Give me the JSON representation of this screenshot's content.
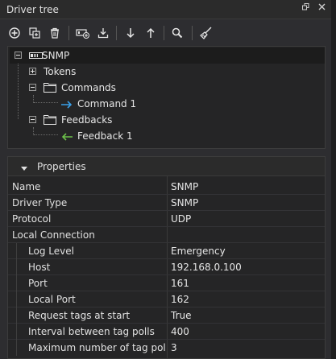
{
  "window": {
    "title": "Driver tree"
  },
  "toolbar": {
    "buttons": [
      {
        "icon": "add-icon"
      },
      {
        "icon": "copy-icon"
      },
      {
        "icon": "delete-icon"
      },
      {
        "icon": "add-device-icon"
      },
      {
        "icon": "import-icon"
      },
      {
        "icon": "move-down-icon"
      },
      {
        "icon": "move-up-icon"
      },
      {
        "icon": "search-icon"
      },
      {
        "icon": "clean-icon"
      }
    ]
  },
  "tree": {
    "root": {
      "label": "SNMP",
      "badge": "snmp-icon"
    },
    "tokens": {
      "label": "Tokens"
    },
    "commands": {
      "label": "Commands",
      "children": [
        {
          "label": "Command 1"
        }
      ]
    },
    "feedbacks": {
      "label": "Feedbacks",
      "children": [
        {
          "label": "Feedback 1"
        }
      ]
    },
    "colors": {
      "command_arrow": "#3aa0e8",
      "feedback_arrow": "#6cc04a"
    }
  },
  "properties": {
    "header": "Properties",
    "rows": [
      {
        "key": "Name",
        "value": "SNMP"
      },
      {
        "key": "Driver Type",
        "value": "SNMP"
      },
      {
        "key": "Protocol",
        "value": "UDP"
      },
      {
        "key": "Local Connection",
        "value": ""
      },
      {
        "key": "Log Level",
        "value": "Emergency"
      },
      {
        "key": "Host",
        "value": "192.168.0.100"
      },
      {
        "key": "Port",
        "value": "161"
      },
      {
        "key": "Local Port",
        "value": "162"
      },
      {
        "key": "Request tags at start",
        "value": "True"
      },
      {
        "key": "Interval between tag polls",
        "value": "400"
      },
      {
        "key": "Maximum number of tag polls",
        "value": "3"
      }
    ]
  }
}
